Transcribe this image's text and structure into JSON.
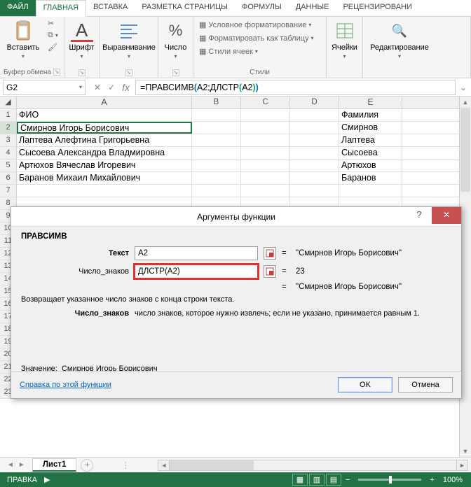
{
  "tabs": {
    "file": "ФАЙЛ",
    "home": "ГЛАВНАЯ",
    "insert": "ВСТАВКА",
    "layout": "РАЗМЕТКА СТРАНИЦЫ",
    "formulas": "ФОРМУЛЫ",
    "data": "ДАННЫЕ",
    "review": "РЕЦЕНЗИРОВАНИ"
  },
  "ribbon": {
    "paste": "Вставить",
    "clipboard": "Буфер обмена",
    "font": "Шрифт",
    "align": "Выравнивание",
    "number": "Число",
    "styles": "Стили",
    "condfmt": "Условное форматирование",
    "fmttable": "Форматировать как таблицу",
    "cellstyles": "Стили ячеек",
    "cells": "Ячейки",
    "editing": "Редактирование"
  },
  "namebox": "G2",
  "formula": {
    "pre": "=ПРАВСИМВ",
    "open": "(",
    "a": "A2;ДЛСТР",
    "open2": "(",
    "b": "A2",
    "close2": ")",
    "close": ")"
  },
  "cols": {
    "A": "A",
    "B": "B",
    "C": "C",
    "D": "D",
    "E": "E"
  },
  "rows": [
    {
      "n": "1",
      "a": "ФИО",
      "e": "Фамилия"
    },
    {
      "n": "2",
      "a": "Смирнов Игорь Борисович",
      "e": "Смирнов"
    },
    {
      "n": "3",
      "a": "Лаптева Алефтина Григорьевна",
      "e": "Лаптева"
    },
    {
      "n": "4",
      "a": "Сысоева Александра Владмировна",
      "e": "Сысоева"
    },
    {
      "n": "5",
      "a": "Артюхов Вячеслав Игоревич",
      "e": "Артюхов"
    },
    {
      "n": "6",
      "a": "Баранов Михаил Михайлович",
      "e": "Баранов"
    },
    {
      "n": "7",
      "a": "",
      "e": ""
    },
    {
      "n": "8",
      "a": "",
      "e": ""
    },
    {
      "n": "9",
      "a": "",
      "e": ""
    },
    {
      "n": "10",
      "a": "",
      "e": ""
    },
    {
      "n": "11",
      "a": "",
      "e": ""
    },
    {
      "n": "12",
      "a": "",
      "e": ""
    },
    {
      "n": "13",
      "a": "",
      "e": ""
    },
    {
      "n": "14",
      "a": "",
      "e": ""
    },
    {
      "n": "15",
      "a": "",
      "e": ""
    },
    {
      "n": "16",
      "a": "",
      "e": ""
    },
    {
      "n": "17",
      "a": "",
      "e": ""
    },
    {
      "n": "18",
      "a": "",
      "e": ""
    },
    {
      "n": "19",
      "a": "",
      "e": ""
    },
    {
      "n": "20",
      "a": "",
      "e": ""
    },
    {
      "n": "21",
      "a": "",
      "e": ""
    },
    {
      "n": "22",
      "a": "",
      "e": ""
    },
    {
      "n": "23",
      "a": "",
      "e": ""
    }
  ],
  "dialog": {
    "title": "Аргументы функции",
    "fn": "ПРАВСИМВ",
    "arg1_label": "Текст",
    "arg1_val": "A2",
    "arg1_res": "\"Смирнов Игорь Борисович\"",
    "arg2_label": "Число_знаков",
    "arg2_val": "ДЛСТР(A2)",
    "arg2_res": "23",
    "preview": "\"Смирнов Игорь Борисович\"",
    "desc": "Возвращает указанное число знаков с конца строки текста.",
    "arg2_name": "Число_знаков",
    "arg2_desc": "число знаков, которое нужно извлечь; если не указано, принимается равным 1.",
    "value_label": "Значение:",
    "value": "Смирнов Игорь Борисович",
    "help": "Справка по этой функции",
    "ok": "OK",
    "cancel": "Отмена"
  },
  "sheet": {
    "name": "Лист1"
  },
  "status": {
    "mode": "ПРАВКА",
    "zoom": "100%"
  }
}
